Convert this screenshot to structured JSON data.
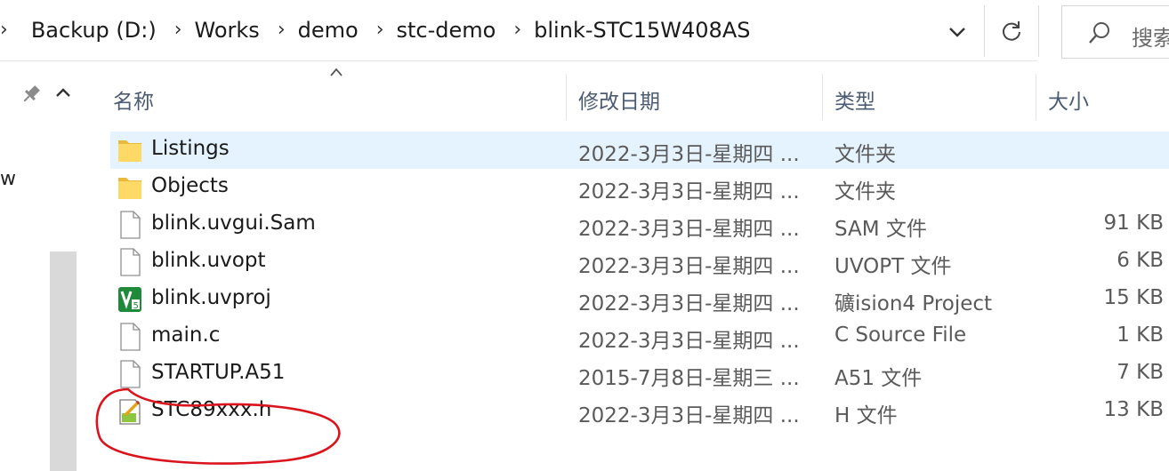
{
  "address": {
    "crumbs": [
      "Backup (D:)",
      "Works",
      "demo",
      "stc-demo",
      "blink-STC15W408AS"
    ],
    "history_icon": "chevron-down-icon",
    "refresh_icon": "refresh-icon"
  },
  "search": {
    "placeholder": "搜索",
    "icon": "search-icon"
  },
  "nav": {
    "partial_label": "w"
  },
  "columns": {
    "name": "名称",
    "date": "修改日期",
    "type": "类型",
    "size": "大小"
  },
  "files": [
    {
      "name": "Listings",
      "date": "2022-3月3日-星期四 ...",
      "type": "文件夹",
      "size": "",
      "icon": "folder-icon",
      "selected": true
    },
    {
      "name": "Objects",
      "date": "2022-3月3日-星期四 ...",
      "type": "文件夹",
      "size": "",
      "icon": "folder-icon",
      "selected": false
    },
    {
      "name": "blink.uvgui.Sam",
      "date": "2022-3月3日-星期四 ...",
      "type": "SAM 文件",
      "size": "91 KB",
      "icon": "file-icon",
      "selected": false
    },
    {
      "name": "blink.uvopt",
      "date": "2022-3月3日-星期四 ...",
      "type": "UVOPT 文件",
      "size": "6 KB",
      "icon": "file-icon",
      "selected": false
    },
    {
      "name": "blink.uvproj",
      "date": "2022-3月3日-星期四 ...",
      "type": "礦ision4 Project",
      "size": "15 KB",
      "icon": "uvision-icon",
      "selected": false
    },
    {
      "name": "main.c",
      "date": "2022-3月3日-星期四 ...",
      "type": "C Source File",
      "size": "1 KB",
      "icon": "file-icon",
      "selected": false
    },
    {
      "name": "STARTUP.A51",
      "date": "2015-7月8日-星期三 ...",
      "type": "A51 文件",
      "size": "7 KB",
      "icon": "file-icon",
      "selected": false
    },
    {
      "name": "STC89xxx.h",
      "date": "2022-3月3日-星期四 ...",
      "type": "H 文件",
      "size": "13 KB",
      "icon": "edit-file-icon",
      "selected": false
    }
  ],
  "colors": {
    "selection": "#e5f3ff",
    "header_text": "#4b5b73",
    "annotation": "#d9141c"
  }
}
